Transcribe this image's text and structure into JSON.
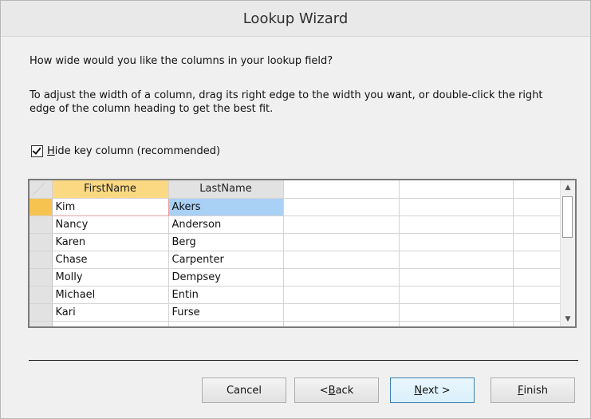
{
  "dialog": {
    "title": "Lookup Wizard"
  },
  "prompt": {
    "question": "How wide would you like the columns in your lookup field?",
    "instructions": "To adjust the width of a column, drag its right edge to the width you want, or double-click the right edge of the column heading to get the best fit."
  },
  "hide_key": {
    "checked": true,
    "label_access_key": "H",
    "label_rest": "ide key column (recommended)"
  },
  "grid": {
    "columns": [
      "FirstName",
      "LastName"
    ],
    "rows": [
      [
        "Kim",
        "Akers"
      ],
      [
        "Nancy",
        "Anderson"
      ],
      [
        "Karen",
        "Berg"
      ],
      [
        "Chase",
        "Carpenter"
      ],
      [
        "Molly",
        "Dempsey"
      ],
      [
        "Michael",
        "Entin"
      ],
      [
        "Kari",
        "Furse"
      ]
    ]
  },
  "buttons": {
    "cancel": "Cancel",
    "back_prefix": "< ",
    "back_key": "B",
    "back_rest": "ack",
    "next_key": "N",
    "next_rest": "ext >",
    "finish_key": "F",
    "finish_rest": "inish"
  },
  "icons": {
    "scroll_up": "▲",
    "scroll_down": "▼"
  },
  "colors": {
    "current_row_selector": "#f6c250",
    "selected_cell": "#a9d0f5",
    "active_header": "#fbd983"
  }
}
